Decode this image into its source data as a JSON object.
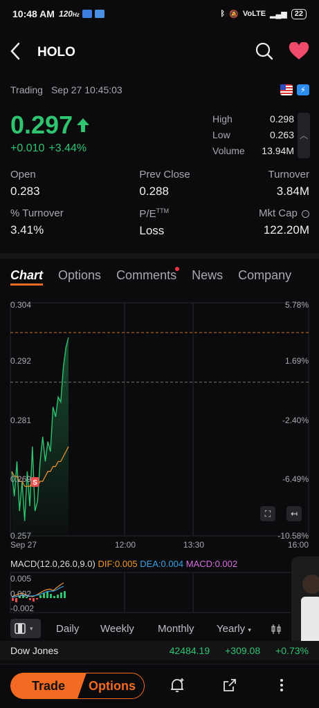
{
  "status_bar": {
    "time": "10:48 AM",
    "refresh": "120",
    "refresh_unit": "Hz",
    "network": "VoLTE",
    "battery": "22"
  },
  "header": {
    "title": "HOLO"
  },
  "session": {
    "state": "Trading",
    "timestamp": "Sep 27 10:45:03"
  },
  "quote": {
    "price": "0.297",
    "change": "+0.010",
    "change_pct": "+3.44%"
  },
  "hlv": [
    {
      "label": "High",
      "value": "0.298"
    },
    {
      "label": "Low",
      "value": "0.263"
    },
    {
      "label": "Volume",
      "value": "13.94M"
    }
  ],
  "stats": {
    "open": {
      "label": "Open",
      "value": "0.283"
    },
    "prev_close": {
      "label": "Prev Close",
      "value": "0.288"
    },
    "turnover": {
      "label": "Turnover",
      "value": "3.84M"
    },
    "pct_turnover": {
      "label": "% Turnover",
      "value": "3.41%"
    },
    "pe": {
      "label": "P/E",
      "label_sup": "TTM",
      "value": "Loss"
    },
    "mkt_cap": {
      "label": "Mkt Cap",
      "value": "122.20M"
    }
  },
  "tabs": [
    "Chart",
    "Options",
    "Comments",
    "News",
    "Company"
  ],
  "chart_data": {
    "type": "line",
    "y_left_ticks": [
      "0.304",
      "0.292",
      "0.281",
      "0.269",
      "0.257"
    ],
    "y_right_ticks": [
      "5.78%",
      "1.69%",
      "-2.40%",
      "-6.49%",
      "-10.58%"
    ],
    "x_ticks": [
      "Sep 27",
      "12:00",
      "13:30",
      "16:00"
    ],
    "ylim": [
      0.257,
      0.304
    ],
    "prev_close": 0.288,
    "high_line": 0.298,
    "price_series": [
      0.27,
      0.265,
      0.272,
      0.262,
      0.268,
      0.26,
      0.27,
      0.263,
      0.275,
      0.262,
      0.264,
      0.272,
      0.277,
      0.272,
      0.276,
      0.274,
      0.283,
      0.281,
      0.285,
      0.284,
      0.291,
      0.295,
      0.297
    ],
    "avg_series": [
      0.27,
      0.269,
      0.269,
      0.268,
      0.268,
      0.267,
      0.267,
      0.267,
      0.268,
      0.268,
      0.267,
      0.268,
      0.268,
      0.269,
      0.27,
      0.27,
      0.271,
      0.271,
      0.272,
      0.272,
      0.273,
      0.274,
      0.275
    ],
    "marker": "S",
    "colors": {
      "price": "#2fc46f",
      "avg": "#f3962a",
      "high_line": "#c8742e",
      "prev_line": "#777777"
    }
  },
  "macd": {
    "params": "MACD(12.0,26.0,9.0)",
    "dif_label": "DIF:0.005",
    "dea_label": "DEA:0.004",
    "macd_label": "MACD:0.002",
    "ticks": [
      "0.005",
      "0.002",
      "-0.002"
    ],
    "colors": {
      "dif": "#f3962a",
      "dea": "#35a2e6",
      "macd": "#d86fe0"
    }
  },
  "periods": [
    "Daily",
    "Weekly",
    "Monthly",
    "Yearly"
  ],
  "ticker": {
    "name": "Dow Jones",
    "value": "42484.19",
    "change": "+309.08",
    "change_pct": "+0.73%"
  },
  "actions": {
    "trade": "Trade",
    "options": "Options"
  }
}
